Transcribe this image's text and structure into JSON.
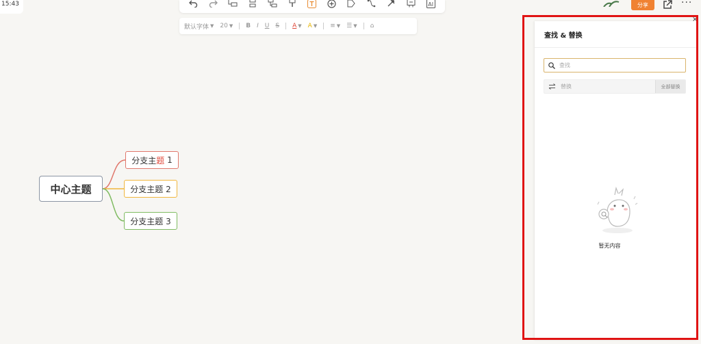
{
  "status": {
    "time": "15:43"
  },
  "toolbar": {
    "icons": [
      "undo-icon",
      "redo-icon",
      "add-sibling-icon",
      "add-child-icon",
      "add-parent-icon",
      "format-painter-icon",
      "text-icon",
      "insert-icon",
      "summary-icon",
      "relation-icon",
      "boundary-icon",
      "label-icon",
      "ai-icon"
    ]
  },
  "format_bar": {
    "font_family": "默认字体",
    "font_size": "20",
    "bold": "B",
    "italic": "I",
    "underline": "U",
    "strikethrough": "S",
    "font_color": "A",
    "highlight": "A"
  },
  "header": {
    "share_label": "分享",
    "more_label": "···"
  },
  "mindmap": {
    "center": "中心主题",
    "branches": [
      {
        "prefix": "分支主",
        "hl": "题",
        "suffix": " 1",
        "color": "#e0776b"
      },
      {
        "label": "分支主题 2",
        "color": "#f0b63d"
      },
      {
        "label": "分支主题 3",
        "color": "#7fbb61"
      }
    ]
  },
  "panel": {
    "title": "查找 & 替换",
    "close": "×",
    "search_placeholder": "查找",
    "replace_placeholder": "替换",
    "replace_all_label": "全部替换",
    "empty_text": "暂无内容"
  },
  "colors": {
    "accent": "#f08232",
    "highlight_frame": "#e01313"
  }
}
